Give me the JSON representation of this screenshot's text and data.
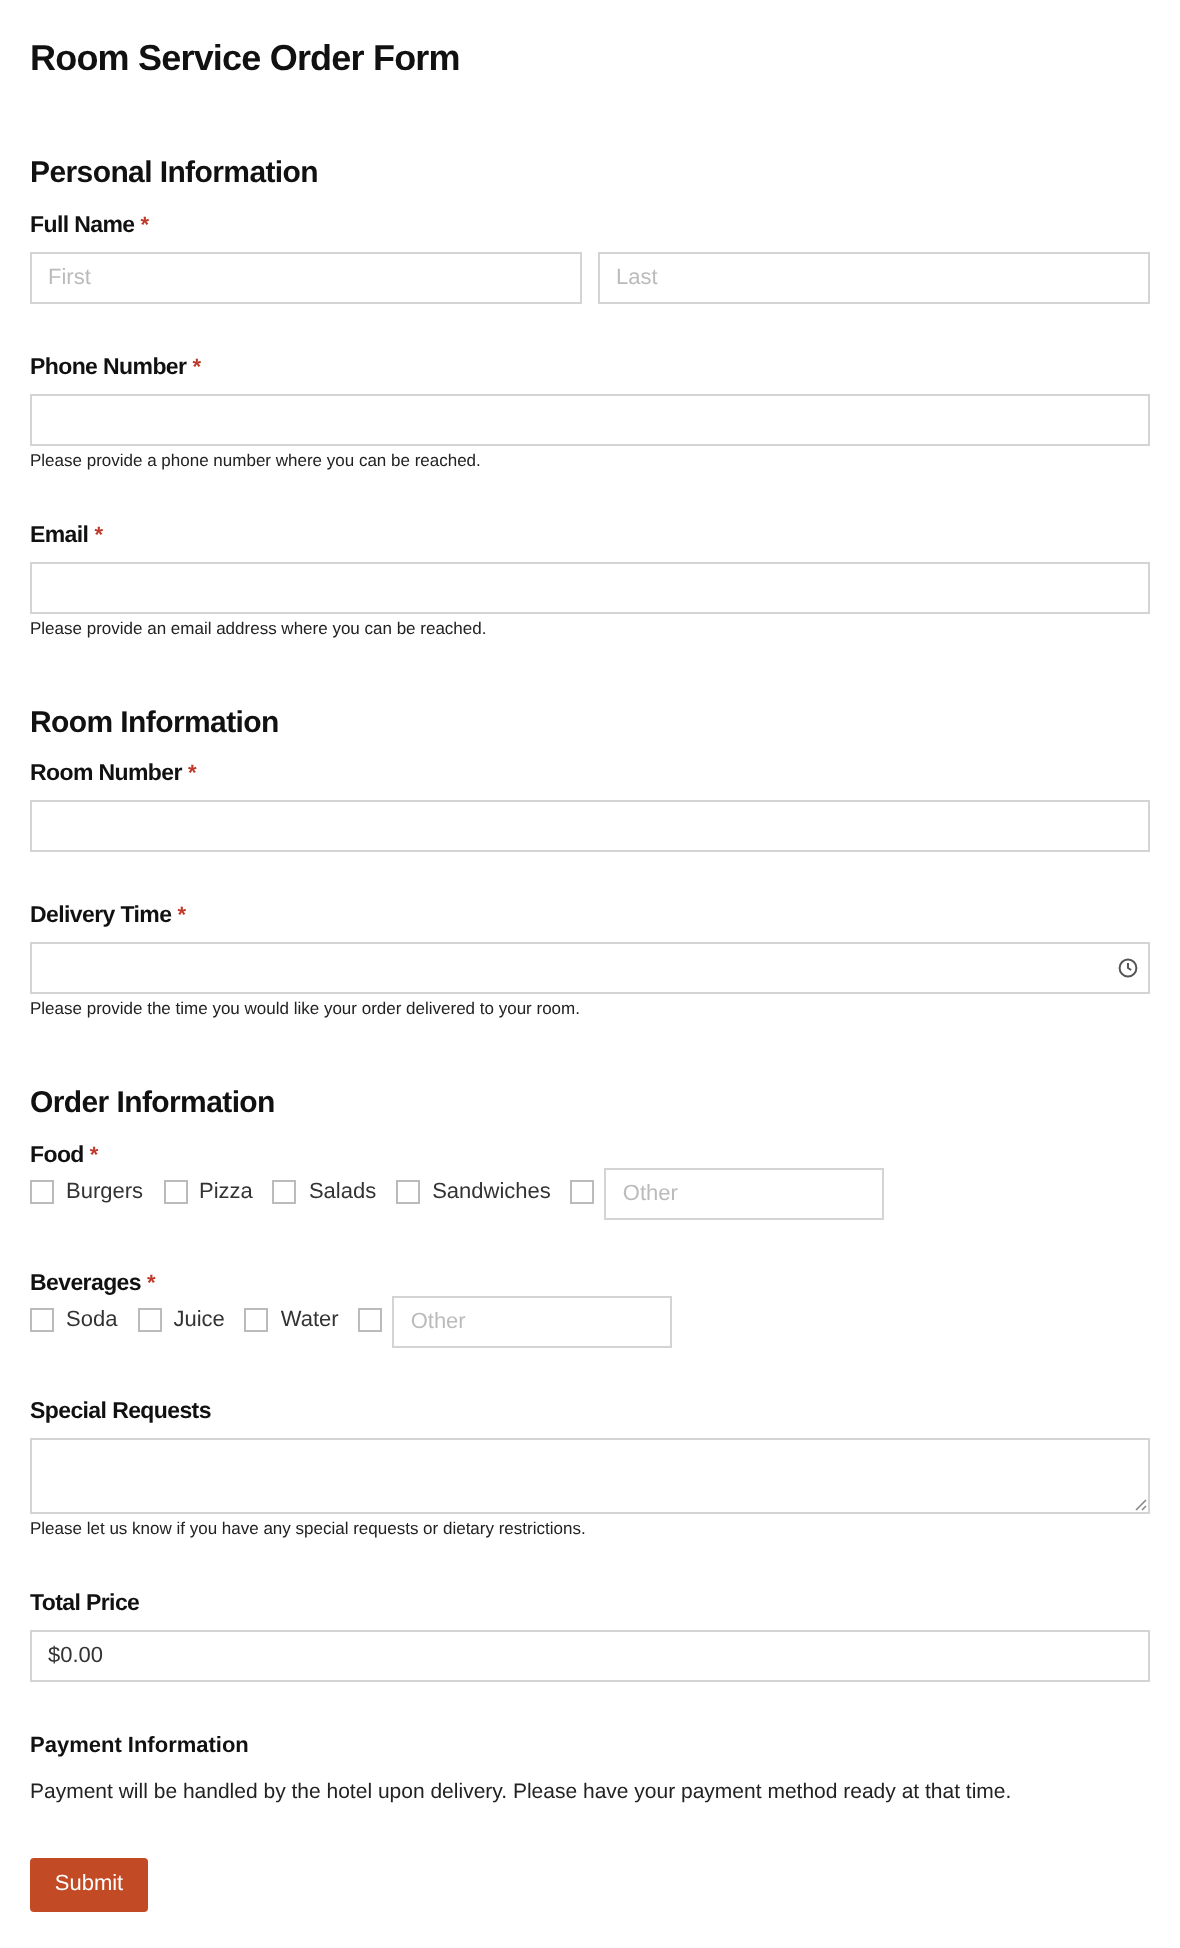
{
  "title": "Room Service Order Form",
  "sections": [
    {
      "heading": "Personal Information",
      "fields": [
        {
          "kind": "name",
          "label": "Full Name",
          "required_mark": "*",
          "placeholders": [
            "First",
            "Last"
          ]
        },
        {
          "kind": "text",
          "label": "Phone Number",
          "required_mark": "*",
          "help": "Please provide a phone number where you can be reached."
        },
        {
          "kind": "text",
          "label": "Email",
          "required_mark": "*",
          "help": "Please provide an email address where you can be reached."
        }
      ]
    },
    {
      "heading": "Room Information",
      "fields": [
        {
          "kind": "text",
          "label": "Room Number",
          "required_mark": "*"
        },
        {
          "kind": "time",
          "label": "Delivery Time",
          "required_mark": "*",
          "help": "Please provide the time you would like your order delivered to your room."
        }
      ]
    },
    {
      "heading": "Order Information",
      "fields": [
        {
          "kind": "checkboxes",
          "label": "Food",
          "required_mark": "*",
          "options": [
            {
              "label": "Burgers",
              "checked": false
            },
            {
              "label": "Pizza",
              "checked": false
            },
            {
              "label": "Salads",
              "checked": false
            },
            {
              "label": "Sandwiches",
              "checked": false
            }
          ],
          "other": {
            "checked": false,
            "placeholder": "Other"
          }
        },
        {
          "kind": "checkboxes",
          "label": "Beverages",
          "required_mark": "*",
          "options": [
            {
              "label": "Soda",
              "checked": false
            },
            {
              "label": "Juice",
              "checked": false
            },
            {
              "label": "Water",
              "checked": false
            }
          ],
          "other": {
            "checked": false,
            "placeholder": "Other"
          }
        },
        {
          "kind": "textarea",
          "label": "Special Requests",
          "help": "Please let us know if you have any special requests or dietary restrictions."
        },
        {
          "kind": "text",
          "label": "Total Price",
          "value": "$0.00"
        }
      ]
    }
  ],
  "payment": {
    "heading": "Payment Information",
    "text": "Payment will be handled by the hotel upon delivery. Please have your payment method ready at that time."
  },
  "submit": "Submit"
}
